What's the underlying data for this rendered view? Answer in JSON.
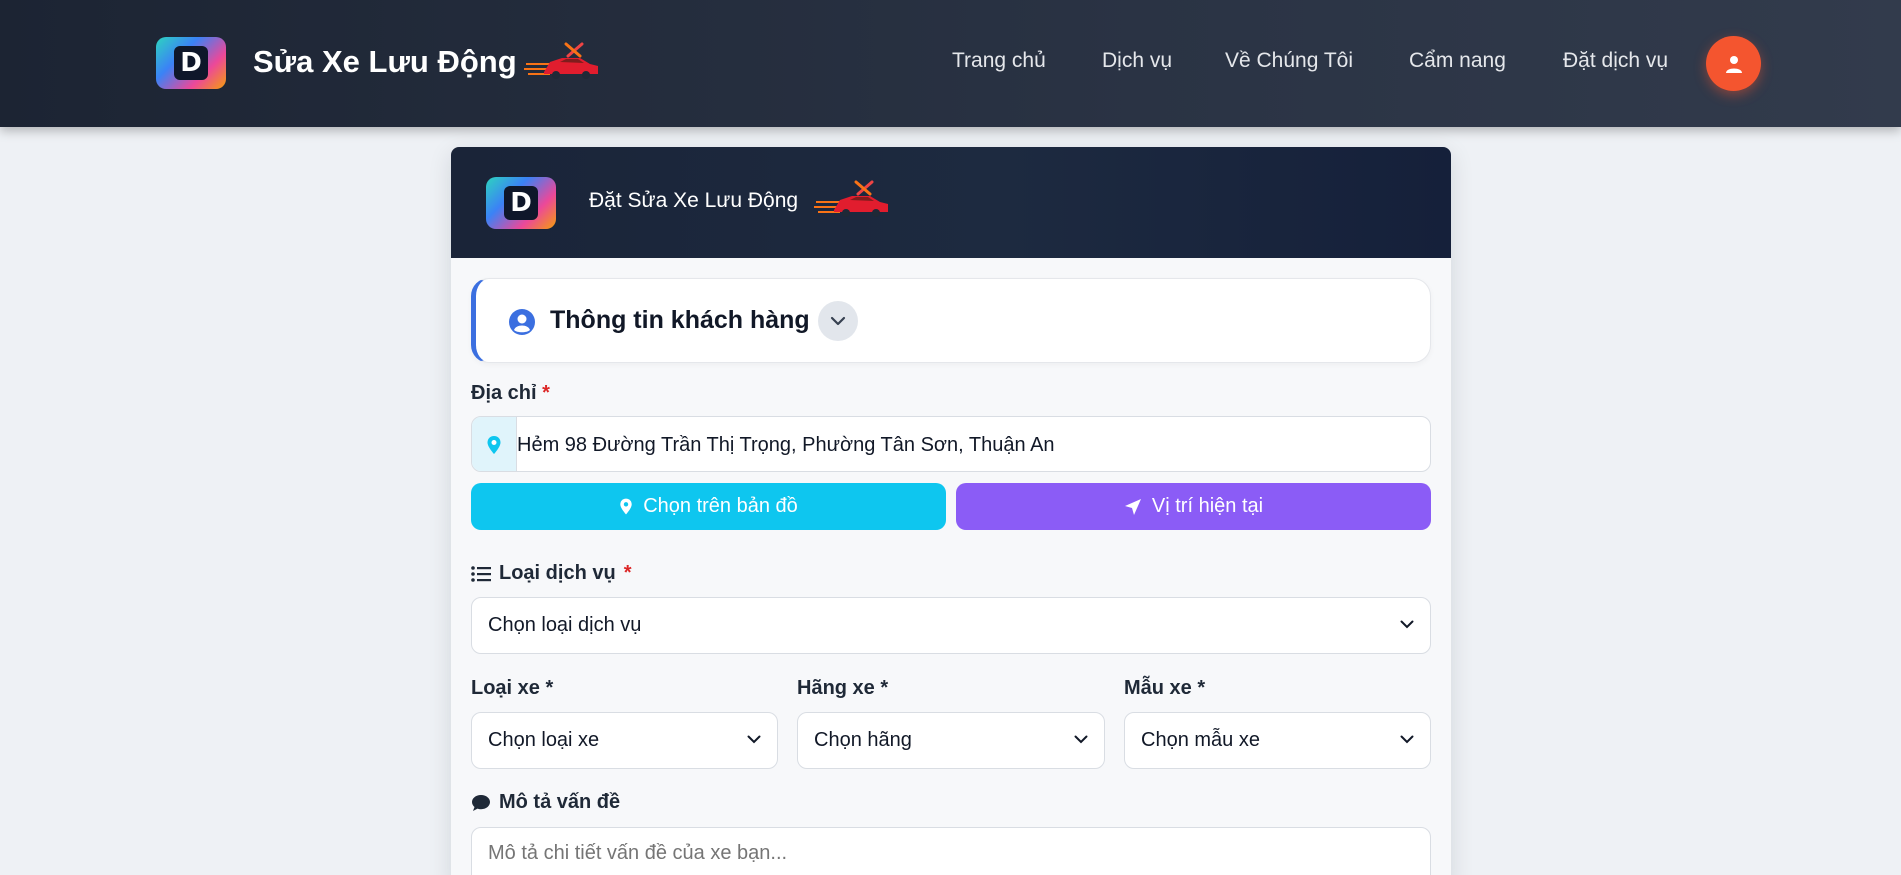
{
  "header": {
    "brand_title": "Sửa Xe Lưu Động",
    "nav": [
      "Trang chủ",
      "Dịch vụ",
      "Về Chúng Tôi",
      "Cẩm nang",
      "Đặt dịch vụ"
    ]
  },
  "card": {
    "title": "Đặt Sửa Xe Lưu Động",
    "section_title": "Thông tin khách hàng",
    "address": {
      "label": "Địa chỉ",
      "required_mark": "*",
      "value": "Hẻm 98 Đường Trần Thị Trọng, Phường Tân Sơn, Thuận An"
    },
    "buttons": {
      "map": "Chọn trên bản đồ",
      "current": "Vị trí hiện tại"
    },
    "service": {
      "label": "Loại dịch vụ",
      "required_mark": "*",
      "selected": "Chọn loại dịch vụ"
    },
    "vehicle_type": {
      "label": "Loại xe *",
      "selected": "Chọn loại xe"
    },
    "brand": {
      "label": "Hãng xe *",
      "selected": "Chọn hãng"
    },
    "model": {
      "label": "Mẫu xe *",
      "selected": "Chọn mẫu xe"
    },
    "description": {
      "label": "Mô tả vấn đề",
      "placeholder": "Mô tả chi tiết vấn đề của xe bạn..."
    }
  },
  "colors": {
    "accent_orange": "#f4552f",
    "cyan": "#0ec6ef",
    "purple": "#8b5cf6",
    "section_accent": "#3b6fe0"
  }
}
